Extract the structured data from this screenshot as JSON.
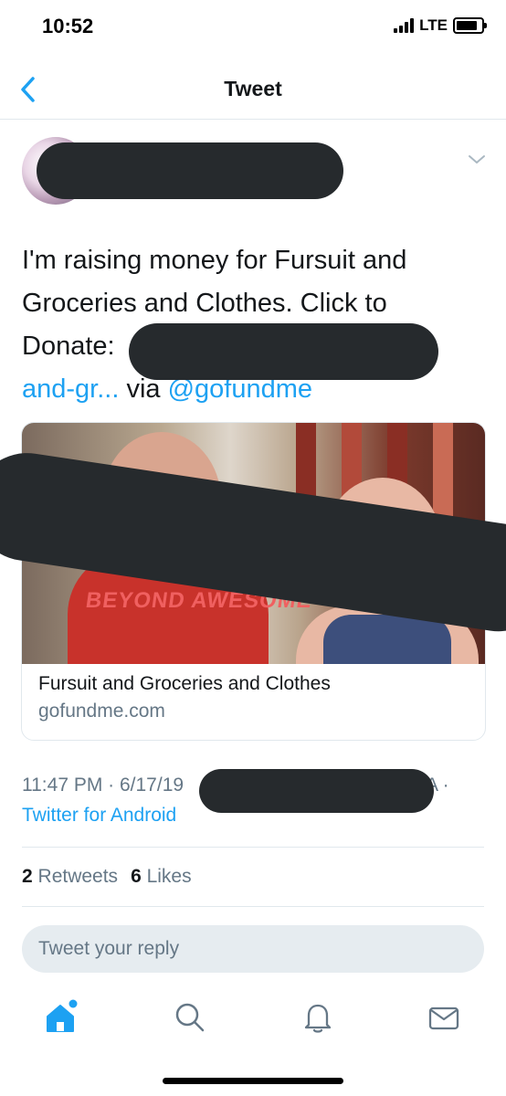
{
  "status_bar": {
    "time": "10:52",
    "network": "LTE"
  },
  "nav": {
    "title": "Tweet"
  },
  "tweet": {
    "text_line1": "I'm raising money for Fursuit and",
    "text_line2": "Groceries and Clothes. Click to",
    "text_line3": "Donate:",
    "link_fragment": "and-gr...",
    "via": " via ",
    "mention": "@gofundme"
  },
  "card": {
    "image_text": "BEYOND AWESOME",
    "title": "Fursuit and Groceries and Clothes",
    "domain": "gofundme.com"
  },
  "meta": {
    "time": "11:47 PM · 6/17/19",
    "tail": "A ·",
    "source": "Twitter for Android"
  },
  "stats": {
    "retweets_count": "2",
    "retweets_label": " Retweets",
    "likes_count": "6",
    "likes_label": " Likes"
  },
  "reply": {
    "placeholder": "Tweet your reply"
  },
  "colors": {
    "accent": "#1da1f2",
    "secondary_text": "#657786",
    "redaction": "#262a2d"
  },
  "tabs": [
    "home-icon",
    "search-icon",
    "notifications-icon",
    "messages-icon"
  ]
}
